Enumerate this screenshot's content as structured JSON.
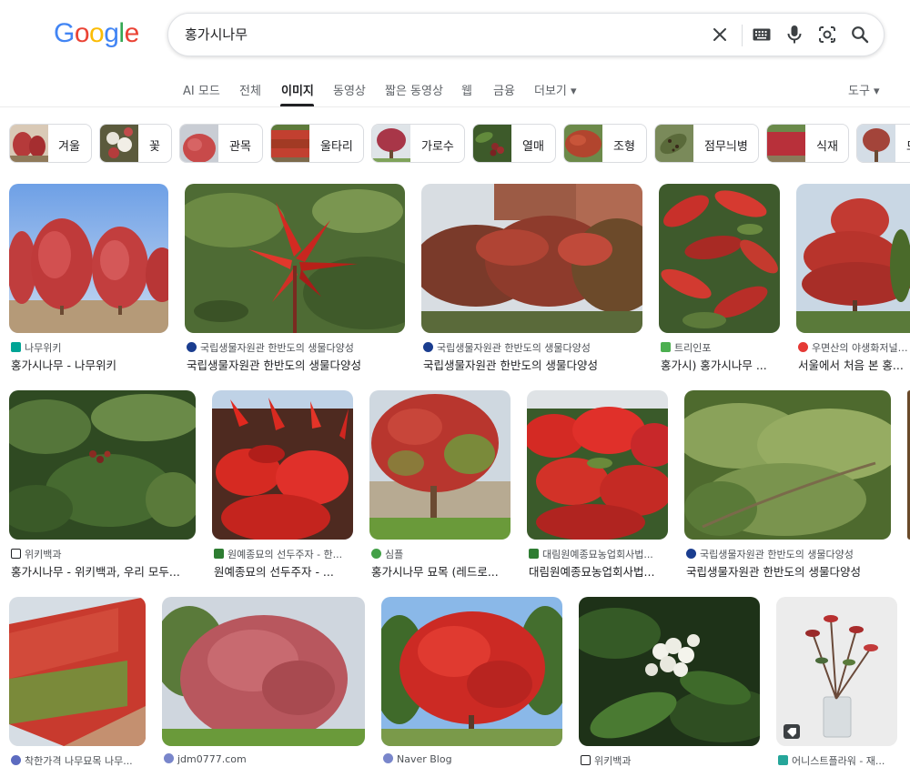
{
  "logo": {
    "text": "Google",
    "letters": [
      "G",
      "o",
      "o",
      "g",
      "l",
      "e"
    ],
    "colors": [
      "#4285F4",
      "#EA4335",
      "#FBBC05",
      "#4285F4",
      "#34A853",
      "#EA4335"
    ]
  },
  "search": {
    "value": "홍가시나무"
  },
  "icons": {
    "clear": "close-icon",
    "keyboard": "keyboard-icon",
    "voice": "microphone-icon",
    "lens": "camera-lens-icon",
    "search": "search-icon"
  },
  "tabs": [
    {
      "label": "AI 모드"
    },
    {
      "label": "전체"
    },
    {
      "label": "이미지",
      "active": true
    },
    {
      "label": "동영상"
    },
    {
      "label": "짧은 동영상"
    },
    {
      "label": "웹"
    },
    {
      "label": "금융"
    },
    {
      "label": "더보기 ▾"
    }
  ],
  "tools_label": "도구 ▾",
  "chips": [
    {
      "label": "겨울",
      "color": "#b53a3a"
    },
    {
      "label": "꽃",
      "color": "#7a6a5a"
    },
    {
      "label": "관목",
      "color": "#c84a4a"
    },
    {
      "label": "울타리",
      "color": "#c24030"
    },
    {
      "label": "가로수",
      "color": "#a83648"
    },
    {
      "label": "열매",
      "color": "#8a2a2a"
    },
    {
      "label": "조형",
      "color": "#b2452e"
    },
    {
      "label": "점무늬병",
      "color": "#5a6a3a"
    },
    {
      "label": "식재",
      "color": "#b8303a"
    },
    {
      "label": "모",
      "color": "#a3443a"
    }
  ],
  "results": [
    {
      "source": "나무위키",
      "title": "홍가시나무 - 나무위키",
      "favicon_color": "#00a495"
    },
    {
      "source": "국립생물자원관 한반도의 생물다양성",
      "title": "국립생물자원관 한반도의 생물다양성",
      "favicon_color": "#1a3d8f"
    },
    {
      "source": "국립생물자원관 한반도의 생물다양성",
      "title": "국립생물자원관 한반도의 생물다양성",
      "favicon_color": "#1a3d8f"
    },
    {
      "source": "트리인포",
      "title": "홍가시) 홍가시나무 ...",
      "favicon_color": "#4caf50"
    },
    {
      "source": "우면산의 야생화저널 ...",
      "title": "서울에서 처음 본 홍...",
      "favicon_color": "#e53935"
    },
    {
      "source": "위키백과",
      "title": "홍가시나무 - 위키백과, 우리 모두...",
      "favicon_color": "#202124"
    },
    {
      "source": "원예종묘의 선두주자 - 한...",
      "title": "원예종묘의 선두주자 - ...",
      "favicon_color": "#2e7d32"
    },
    {
      "source": "심플",
      "title": "홍가시나무 묘목 (레드로...",
      "favicon_color": "#43a047"
    },
    {
      "source": "대림원예종묘농업회사법...",
      "title": "대림원예종묘농업회사법...",
      "favicon_color": "#2e7d32"
    },
    {
      "source": "국립생물자원관 한반도의 생물다양성",
      "title": "국립생물자원관 한반도의 생물다양성",
      "favicon_color": "#1a3d8f"
    },
    {
      "source": "착한가격 나무묘목 나무...",
      "title": "",
      "favicon_color": "#5c6bc0"
    },
    {
      "source": "jdm0777.com",
      "title": "",
      "favicon_color": "#7986cb"
    },
    {
      "source": "Naver Blog",
      "title": "",
      "favicon_color": "#7986cb"
    },
    {
      "source": "위키백과",
      "title": "",
      "favicon_color": "#202124"
    },
    {
      "source": "어니스트플라워 - 재...",
      "title": "",
      "favicon_color": "#26a69a"
    }
  ]
}
